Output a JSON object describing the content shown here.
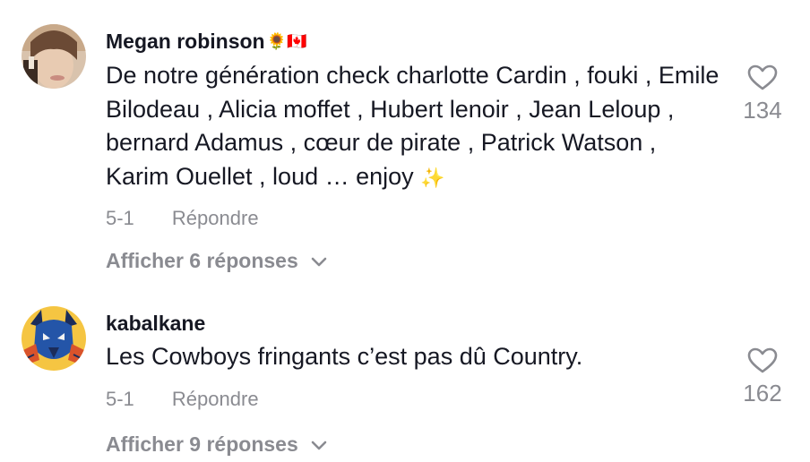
{
  "comments": [
    {
      "username": "Megan robinson",
      "username_emojis": "🌻🇨🇦",
      "text": "De notre génération check charlotte Cardin , fouki , Emile Bilodeau , Alicia moffet , Hubert lenoir , Jean Leloup , bernard Adamus , cœur de pirate , Patrick Watson , Karim Ouellet , loud … enjoy",
      "trailing_emoji": "✨",
      "date": "5-1",
      "reply_label": "Répondre",
      "view_replies_label": "Afficher 6 réponses",
      "like_count": "134",
      "icons": {
        "avatar": "avatar-photo",
        "like": "heart-outline-icon",
        "expand": "chevron-down-icon"
      }
    },
    {
      "username": "kabalkane",
      "text": "Les Cowboys fringants c’est pas dû Country.",
      "date": "5-1",
      "reply_label": "Répondre",
      "view_replies_label": "Afficher 9 réponses",
      "like_count": "162",
      "icons": {
        "avatar": "avatar-illustration",
        "like": "heart-outline-icon",
        "expand": "chevron-down-icon"
      }
    }
  ],
  "colors": {
    "text": "#161823",
    "secondary": "#8a8b91",
    "background": "#ffffff",
    "sparkle": "#f2c94c"
  }
}
